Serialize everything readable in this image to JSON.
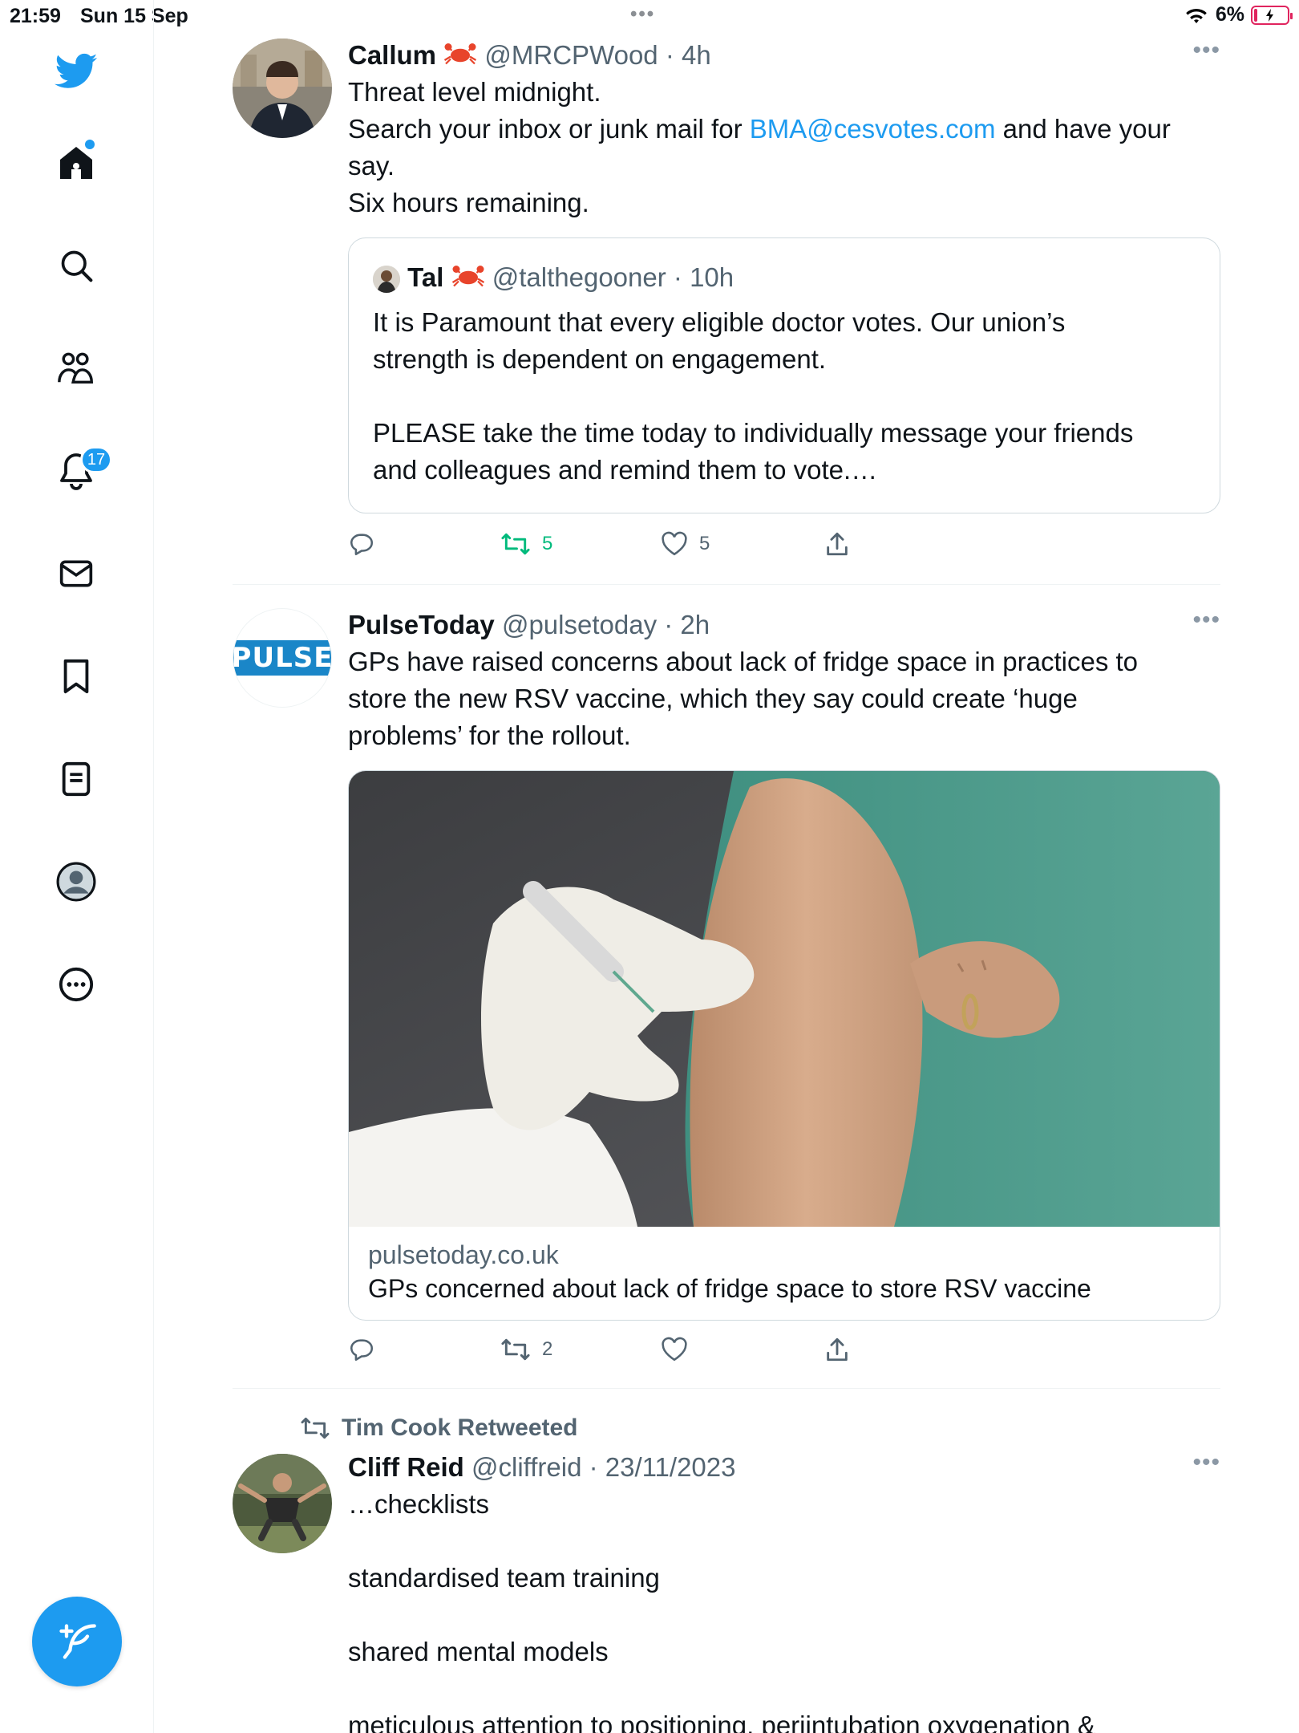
{
  "status_bar": {
    "time": "21:59",
    "date": "Sun 15 Sep",
    "battery": "6%"
  },
  "sidebar": {
    "notifications_badge": "17",
    "items": [
      "twitter-logo",
      "home",
      "search",
      "communities",
      "notifications",
      "messages",
      "bookmarks",
      "lists",
      "profile",
      "more"
    ]
  },
  "tweets": [
    {
      "name": "Callum",
      "handle": "@MRCPWood",
      "time": "4h",
      "lines": [
        "Threat level midnight.",
        "Search your inbox or junk mail for ",
        "BMA@cesvotes.com",
        " and have your",
        "say.",
        "Six hours remaining."
      ],
      "quote": {
        "name": "Tal",
        "handle": "@talthegooner",
        "time": "10h",
        "lines": [
          "It is Paramount that every eligible doctor votes. Our union’s",
          "strength is dependent on engagement.",
          "",
          "PLEASE take the time today to individually message your friends",
          "and colleagues and remind them to vote.…"
        ]
      },
      "actions": {
        "replies": "",
        "retweets": "5",
        "likes": "5"
      }
    },
    {
      "name": "PulseToday",
      "handle": "@pulsetoday",
      "time": "2h",
      "avatar_text": "PULSE",
      "lines": [
        "GPs have raised concerns about lack of fridge space in practices to",
        "store the new RSV vaccine, which they say could create ‘huge",
        "problems’ for the rollout."
      ],
      "card": {
        "domain": "pulsetoday.co.uk",
        "title": "GPs concerned about lack of fridge space to store RSV vaccine"
      },
      "actions": {
        "replies": "",
        "retweets": "2",
        "likes": ""
      }
    },
    {
      "retweeted_by": "Tim Cook Retweeted",
      "name": "Cliff Reid",
      "handle": "@cliffreid",
      "time": "23/11/2023",
      "lines": [
        "…checklists",
        "",
        "standardised team training",
        "",
        "shared mental models",
        "",
        "meticulous attention to positioning, periintubation oxygenation &"
      ]
    }
  ],
  "colors": {
    "accent": "#1d9bf0",
    "retweet_active": "#00ba7c",
    "text": "#0f1419",
    "secondary": "#536471"
  }
}
